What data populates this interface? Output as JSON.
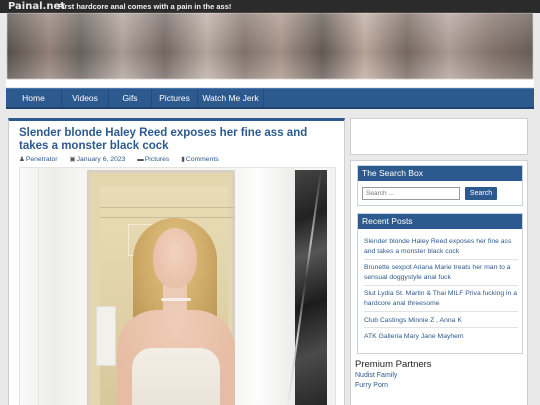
{
  "site": {
    "logo": "Painal.net",
    "tagline": "First hardcore anal comes with a pain in the ass!"
  },
  "nav": {
    "items": [
      "Home",
      "Videos",
      "Gifs",
      "Pictures",
      "Watch Me Jerk"
    ]
  },
  "post": {
    "title": "Slender blonde Haley Reed exposes her fine ass and takes a monster black cock",
    "author": "Penetrator",
    "date": "January 6, 2023",
    "category": "Pictures",
    "comments": "Comments"
  },
  "icons": {
    "author": "user-icon",
    "date": "calendar-icon",
    "category": "folder-icon",
    "comments": "comment-icon"
  },
  "search_box": {
    "title": "The Search Box",
    "placeholder": "Search ...",
    "button": "Search"
  },
  "recent_posts": {
    "title": "Recent Posts",
    "items": [
      "Slender blonde Haley Reed exposes her fine ass and takes a monster black cock",
      "Brunette sexpot Ariana Marie treats her man to a sensual doggystyle anal fuck",
      "Slut Lydia St. Martin & Thai MILF Priva fucking in a hardcore anal threesome",
      "Club Castings Minnie Z , Anna K",
      "ATK Galleria Mary Jane Mayhem"
    ]
  },
  "partners": {
    "title": "Premium Partners",
    "items": [
      "Nudist Family",
      "Furry Porn"
    ]
  },
  "colors": {
    "accent": "#2d5a8e",
    "topbar": "#2b2b2b",
    "background": "#e9e9e9"
  }
}
